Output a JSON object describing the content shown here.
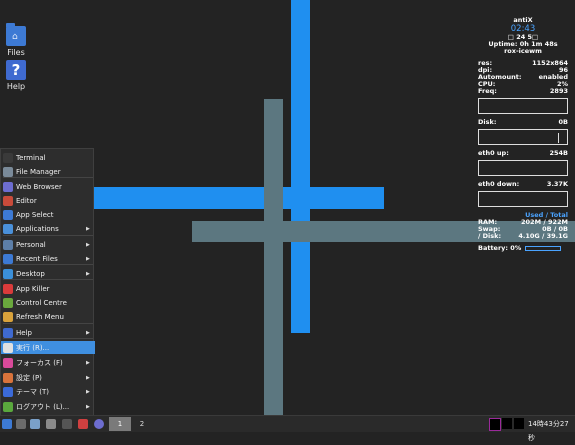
{
  "desktop": {
    "icons": [
      {
        "label": "Files",
        "icon": "folder-home-icon"
      },
      {
        "label": "Help",
        "icon": "help-question-icon"
      }
    ]
  },
  "conky": {
    "host": "antiX",
    "time": "02:43",
    "date": "□ 24 5□",
    "uptime": "Uptime: 0h 1m 48s",
    "wm": "rox-icewm",
    "rows": [
      {
        "label": "res:",
        "value": "1152x864"
      },
      {
        "label": "dpi:",
        "value": "96"
      },
      {
        "label": "Automount:",
        "value": "enabled"
      },
      {
        "label": "CPU:",
        "value": "2%"
      },
      {
        "label": "Freq:",
        "value": "2893"
      }
    ],
    "disk": {
      "label": "Disk:",
      "value": "0B"
    },
    "eth_up": {
      "label": "eth0 up:",
      "value": "254B"
    },
    "eth_down": {
      "label": "eth0 down:",
      "value": "3.37K"
    },
    "used_total": "Used / Total",
    "mem": [
      {
        "label": "RAM:",
        "value": "202M / 922M"
      },
      {
        "label": "Swap:",
        "value": "0B / 0B"
      },
      {
        "label": "/ Disk:",
        "value": "4.10G / 39.1G"
      }
    ],
    "battery": {
      "label": "Battery: 0%",
      "level": 0
    }
  },
  "menu": {
    "items": [
      {
        "label": "Terminal",
        "icon": "terminal-icon",
        "color": "#3a3a3a",
        "submenu": false
      },
      {
        "label": "File Manager",
        "icon": "file-manager-icon",
        "color": "#7a8a99",
        "submenu": false
      },
      {
        "label": "Web Browser",
        "icon": "web-browser-icon",
        "color": "#6d6dd0",
        "submenu": false
      },
      {
        "label": "Editor",
        "icon": "editor-icon",
        "color": "#c94b3a",
        "submenu": false
      },
      {
        "label": "App Select",
        "icon": "app-select-icon",
        "color": "#3d7ad4",
        "submenu": false
      },
      {
        "label": "Applications",
        "icon": "applications-icon",
        "color": "#4a90d9",
        "submenu": true
      },
      {
        "label": "Personal",
        "icon": "personal-icon",
        "color": "#5d7fa8",
        "submenu": true
      },
      {
        "label": "Recent Files",
        "icon": "recent-files-icon",
        "color": "#3d7ad4",
        "submenu": true
      },
      {
        "label": "Desktop",
        "icon": "desktop-icon",
        "color": "#3b8fd8",
        "submenu": true
      },
      {
        "label": "App Killer",
        "icon": "app-killer-icon",
        "color": "#d93b3b",
        "submenu": false
      },
      {
        "label": "Control Centre",
        "icon": "control-centre-icon",
        "color": "#6aa83d",
        "submenu": false
      },
      {
        "label": "Refresh Menu",
        "icon": "refresh-menu-icon",
        "color": "#d9a23b",
        "submenu": false
      },
      {
        "label": "Help",
        "icon": "help-icon",
        "color": "#3f6ad0",
        "submenu": true
      },
      {
        "label": "実行 (R)...",
        "icon": "run-icon",
        "color": "#e0e0e0",
        "submenu": false
      },
      {
        "label": "フォーカス (F)",
        "icon": "focus-icon",
        "color": "#d94a9a",
        "submenu": true
      },
      {
        "label": "設定 (P)",
        "icon": "settings-icon",
        "color": "#d9733b",
        "submenu": true
      },
      {
        "label": "テーマ (T)",
        "icon": "theme-icon",
        "color": "#3b6ad9",
        "submenu": true
      },
      {
        "label": "ログアウト (L)...",
        "icon": "logout-icon",
        "color": "#5aa83d",
        "submenu": true
      }
    ]
  },
  "taskbar": {
    "workspaces": [
      "1",
      "2"
    ],
    "clock": "14時43分27秒"
  }
}
